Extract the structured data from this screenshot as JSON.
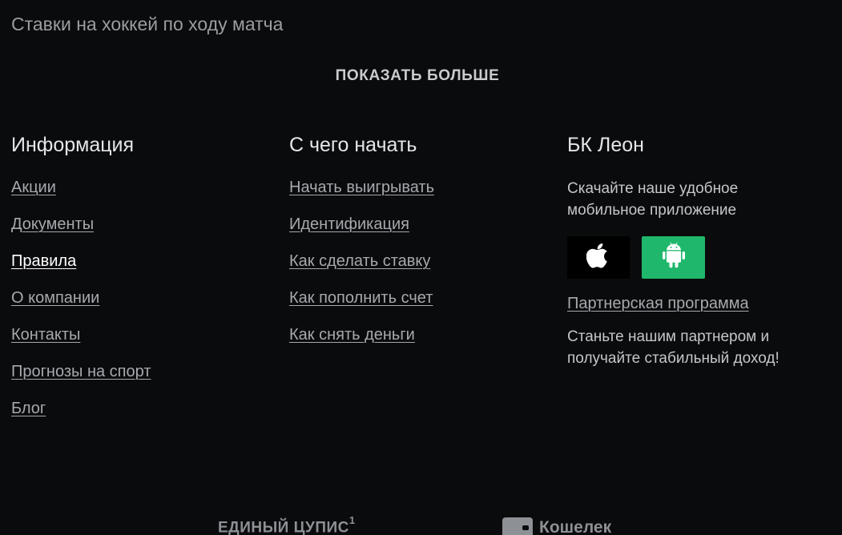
{
  "top": {
    "hockey_live_link": "Ставки на хоккей по ходу матча"
  },
  "show_more": {
    "label": "ПОКАЗАТЬ БОЛЬШЕ"
  },
  "info": {
    "title": "Информация",
    "links": [
      "Акции",
      "Документы",
      "Правила",
      "О компании",
      "Контакты",
      "Прогнозы на спорт",
      "Блог"
    ]
  },
  "start": {
    "title": "С чего начать",
    "links": [
      "Начать выигрывать",
      "Идентификация",
      "Как сделать ставку",
      "Как пополнить счет",
      "Как снять деньги"
    ]
  },
  "bk": {
    "title": "БК Леон",
    "app_desc_line1": "Скачайте наше удобное",
    "app_desc_line2": "мобильное приложение",
    "apple_icon": "apple-icon",
    "android_icon": "android-icon",
    "android_color": "#1fb76c",
    "partner_link": "Партнерская программа",
    "partner_desc_line1": "Станьте нашим партнером и",
    "partner_desc_line2": "получайте стабильный доход!"
  },
  "bottom": {
    "logo_text": "ЕДИНЫЙ ЦУПИС",
    "logo_sup": "1",
    "wallet_label": "Кошелек"
  }
}
